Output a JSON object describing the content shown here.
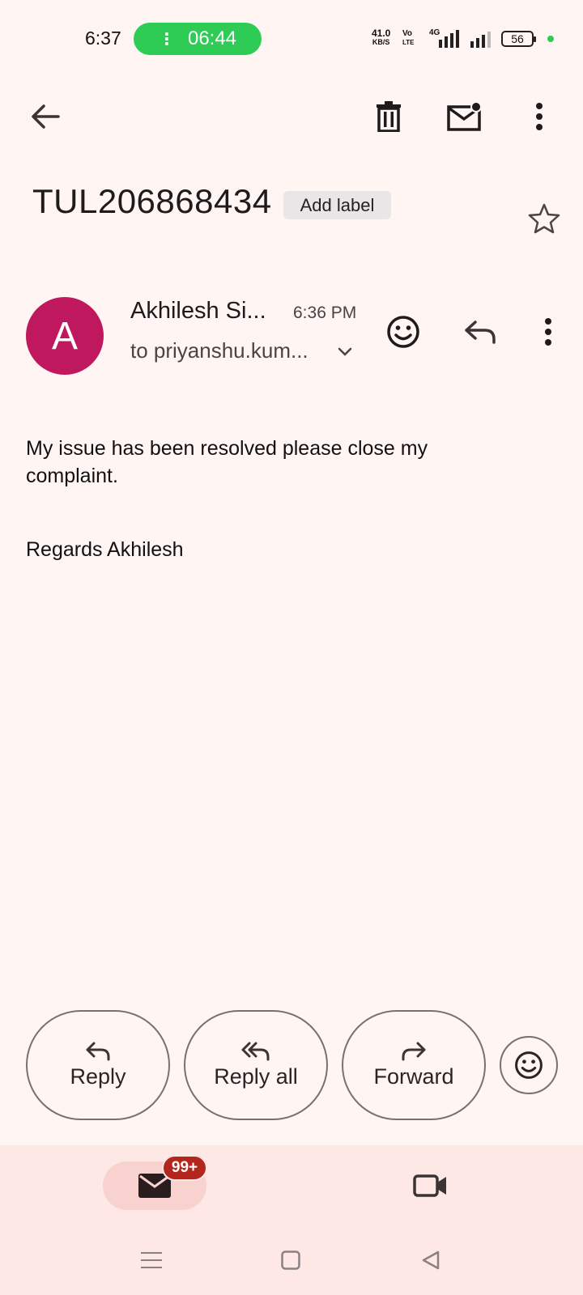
{
  "status_bar": {
    "time": "6:37",
    "call_timer": "06:44",
    "net_speed_value": "41.0",
    "net_speed_unit": "KB/S",
    "volte_top": "Vo",
    "volte_bottom": "LTE",
    "network": "4G",
    "battery": "56"
  },
  "toolbar": {
    "back_icon": "arrow-back-icon",
    "delete_icon": "trash-icon",
    "mark_unread_icon": "mail-unread-icon",
    "more_icon": "more-vert-icon"
  },
  "email": {
    "subject": "TUL206868434",
    "add_label": "Add label",
    "sender_initial": "A",
    "sender_name": "Akhilesh Si...",
    "time": "6:36 PM",
    "recipient": "to priyanshu.kum...",
    "body": "My issue has been resolved please close my complaint.",
    "signature": "Regards Akhilesh"
  },
  "actions": {
    "reply": "Reply",
    "reply_all": "Reply all",
    "forward": "Forward"
  },
  "bottom_nav": {
    "mail_badge": "99+"
  },
  "colors": {
    "background": "#fff5f3",
    "avatar": "#c0185e",
    "call_pill": "#2ecc55",
    "badge": "#b3261e",
    "nav_bg": "#fde8e6"
  }
}
